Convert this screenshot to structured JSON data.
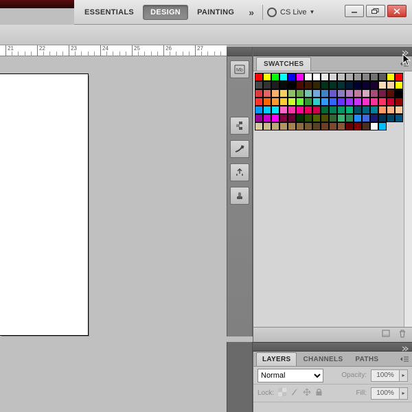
{
  "workspace": {
    "items": [
      {
        "label": "ESSENTIALS",
        "active": false
      },
      {
        "label": "DESIGN",
        "active": true
      },
      {
        "label": "PAINTING",
        "active": false
      }
    ],
    "cslive_label": "CS Live"
  },
  "ruler": {
    "start": 21,
    "end": 27
  },
  "iconstrip": {
    "items": [
      "mini-bridge-icon",
      "history-icon",
      "brush-icon",
      "clone-source-icon",
      "tool-presets-icon"
    ]
  },
  "swatches": {
    "tab_label": "SWATCHES",
    "rows": [
      [
        "#ff0000",
        "#ffff00",
        "#00ff00",
        "#00ffff",
        "#0000ff",
        "#ff00ff",
        "#ffffff",
        "#ffffff",
        "#ebebeb",
        "#d6d6d6",
        "#c2c2c2",
        "#adadad",
        "#999999",
        "#858585",
        "#707070",
        "#5c5c5c",
        "#ffff00",
        "#ff0000"
      ],
      [
        "#474747",
        "#333333",
        "#1f1f1f",
        "#0a0a0a",
        "#000000",
        "#4d0b00",
        "#401900",
        "#332600",
        "#003319",
        "#003326",
        "#003333",
        "#001933",
        "#000033",
        "#0d0033",
        "#1a0033",
        "#f8dbb8",
        "#f5d0a9",
        "#ffff00"
      ],
      [
        "#db3d3d",
        "#e06666",
        "#f5b26b",
        "#f7cf60",
        "#8dbf67",
        "#6aa84f",
        "#76c2af",
        "#6fa8dc",
        "#3d85c6",
        "#6a5acd",
        "#8e7cc3",
        "#b47cc3",
        "#c27ba0",
        "#d5a6bd",
        "#a64d79",
        "#741b47",
        "#5b0f00",
        "#000000"
      ],
      [
        "#ff3333",
        "#ff6600",
        "#ff9933",
        "#ffcc33",
        "#ccff33",
        "#66ff33",
        "#339933",
        "#33cccc",
        "#3399ff",
        "#3366ff",
        "#6633ff",
        "#9933ff",
        "#cc33ff",
        "#ff33cc",
        "#ff3399",
        "#ff3366",
        "#cc0033",
        "#990000"
      ],
      [
        "#0099ff",
        "#00ccff",
        "#00e5ff",
        "#ff66cc",
        "#ff33aa",
        "#ff0099",
        "#e6005c",
        "#cc004d",
        "#006633",
        "#008055",
        "#009966",
        "#00b377",
        "#004d66",
        "#006680",
        "#008099",
        "#ff9966",
        "#ffb380",
        "#ffcc99"
      ],
      [
        "#990099",
        "#cc00cc",
        "#ff00ff",
        "#800040",
        "#660033",
        "#003300",
        "#264d00",
        "#4d6600",
        "#4d4d00",
        "#336633",
        "#3cb371",
        "#2e8b57",
        "#1e90ff",
        "#4169e1",
        "#191970",
        "#003153",
        "#004466",
        "#005580"
      ],
      [
        "#d9c9a3",
        "#ccbb8f",
        "#bfa878",
        "#b39563",
        "#a6824e",
        "#8c6d3f",
        "#735731",
        "#594224",
        "#6b3e26",
        "#7a4a2e",
        "#895636",
        "#660000",
        "#800000",
        "#4b2e1e",
        "#ffffff",
        "#00bfff",
        "#d5d5d5",
        "#d5d5d5"
      ]
    ]
  },
  "layers": {
    "tabs": [
      "LAYERS",
      "CHANNELS",
      "PATHS"
    ],
    "active_tab_index": 0,
    "blend_mode": "Normal",
    "opacity_label": "Opacity:",
    "opacity_value": "100%",
    "lock_label": "Lock:",
    "fill_label": "Fill:",
    "fill_value": "100%"
  }
}
